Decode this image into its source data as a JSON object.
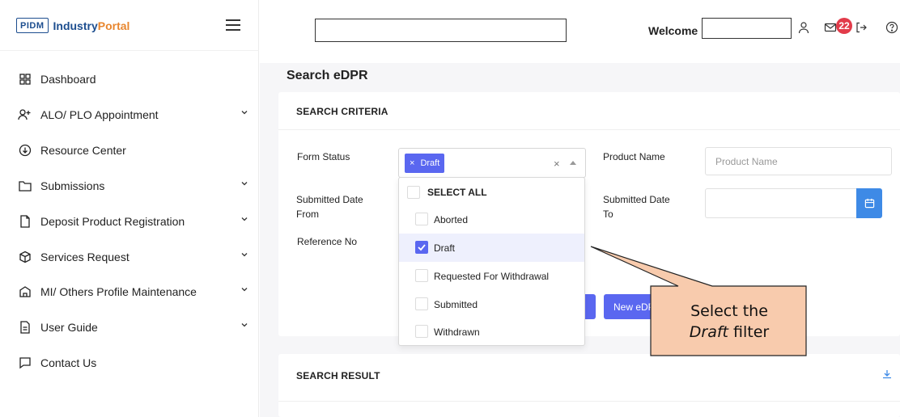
{
  "app": {
    "logo_box": "PIDM",
    "logo_industry": "Industry",
    "logo_portal": "Portal"
  },
  "sidebar": {
    "items": [
      {
        "label": "Dashboard",
        "icon": "grid-icon",
        "has_chevron": false
      },
      {
        "label": "ALO/ PLO Appointment",
        "icon": "user-plus-icon",
        "has_chevron": true
      },
      {
        "label": "Resource Center",
        "icon": "cloud-download-icon",
        "has_chevron": false
      },
      {
        "label": "Submissions",
        "icon": "folder-icon",
        "has_chevron": true
      },
      {
        "label": "Deposit Product Registration",
        "icon": "document-icon",
        "has_chevron": true
      },
      {
        "label": "Services Request",
        "icon": "box-icon",
        "has_chevron": true
      },
      {
        "label": "MI/ Others Profile Maintenance",
        "icon": "building-icon",
        "has_chevron": true
      },
      {
        "label": "User Guide",
        "icon": "file-text-icon",
        "has_chevron": true
      },
      {
        "label": "Contact Us",
        "icon": "chat-icon",
        "has_chevron": false
      }
    ]
  },
  "header": {
    "search_value": "",
    "welcome_label": "Welcome",
    "username_value": "",
    "notification_count": "22"
  },
  "page": {
    "title": "Search eDPR"
  },
  "criteria": {
    "section_title": "SEARCH CRITERIA",
    "form_status_label": "Form Status",
    "selected_chip": "Draft",
    "chip_remove": "×",
    "clear_symbol": "×",
    "product_name_label": "Product Name",
    "product_name_placeholder": "Product Name",
    "submitted_from_label_1": "Submitted Date",
    "submitted_from_label_2": "From",
    "submitted_to_label_1": "Submitted Date",
    "submitted_to_label_2": "To",
    "reference_label": "Reference No",
    "new_button_label": "New eDPR"
  },
  "dropdown": {
    "select_all_label": "SELECT ALL",
    "options": [
      {
        "label": "Aborted",
        "checked": false
      },
      {
        "label": "Draft",
        "checked": true
      },
      {
        "label": "Requested For Withdrawal",
        "checked": false
      },
      {
        "label": "Submitted",
        "checked": false
      },
      {
        "label": "Withdrawn",
        "checked": false
      }
    ]
  },
  "result": {
    "section_title": "SEARCH RESULT"
  },
  "callout": {
    "line1": "Select the",
    "line2_italic": "Draft",
    "line2_rest": " filter",
    "fill_color": "#f8cbad"
  },
  "colors": {
    "accent": "#5a67f0",
    "date_button": "#3e8ae6",
    "badge": "#e23b4a",
    "brand_blue": "#1d4e8f",
    "brand_orange": "#e8862e"
  }
}
